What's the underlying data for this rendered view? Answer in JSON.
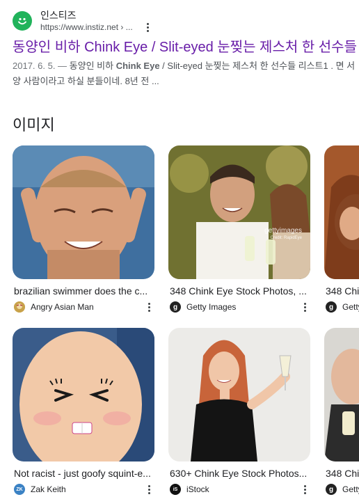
{
  "result": {
    "site_name": "인스티즈",
    "site_url": "https://www.instiz.net › ...",
    "title": "동양인 비하 Chink Eye / Slit-eyed 눈찢는 제스처 한 선수들",
    "snippet_date": "2017. 6. 5. — ",
    "snippet_part1": "동양인 비하 ",
    "snippet_bold": "Chink Eye",
    "snippet_part2": " / Slit-eyed 눈찢는 제스처 한 선수들 리스트1 . 면 서양 사람이라고 하실 분들이네. 8년 전 ..."
  },
  "images_section": {
    "title": "이미지",
    "cards": [
      {
        "caption": "brazilian swimmer does the c...",
        "source": "Angry Asian Man"
      },
      {
        "caption": "348 Chink Eye Stock Photos, ...",
        "source": "Getty Images",
        "watermark": "gettyimages",
        "watermark_credit": "Credit: RapidEye"
      },
      {
        "caption": "348 Chi",
        "source": "Getty"
      },
      {
        "caption": "Not racist - just goofy squint-e...",
        "source": "Zak Keith",
        "source_initial": "ZK"
      },
      {
        "caption": "630+ Chink Eye Stock Photos...",
        "source": "iStock",
        "source_initial": "iS"
      },
      {
        "caption": "348 Chi",
        "source": "Getty"
      }
    ]
  },
  "colors": {
    "visited_link": "#681da8",
    "favicon": "#21b35b"
  },
  "icons": {
    "favicon": "smiley-icon",
    "more": "kebab-menu-icon",
    "getty": "getty-g-icon"
  }
}
